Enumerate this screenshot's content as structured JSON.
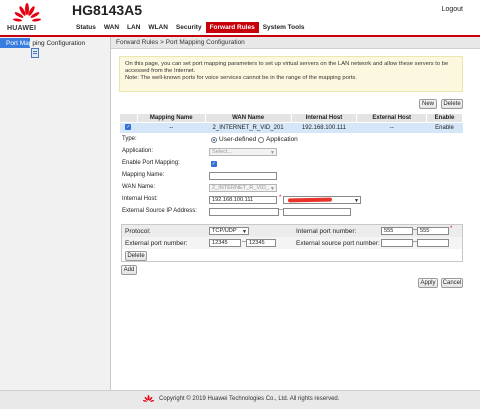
{
  "header": {
    "brand": "HUAWEI",
    "model": "HG8143A5",
    "logout": "Logout",
    "nav": [
      "Status",
      "WAN",
      "LAN",
      "WLAN",
      "Security",
      "Forward Rules",
      "System Tools"
    ],
    "active_nav": "Forward Rules"
  },
  "sidebar": {
    "item_highlight": "Port Map",
    "item_rest": "ping Configuration"
  },
  "breadcrumb": "Forward Rules > Port Mapping Configuration",
  "notice": {
    "line1": "On this page, you can set port mapping parameters to set up virtual servers on the LAN network and allow these servers to be",
    "line2": "accessed from the Internet.",
    "line3": "Note: The well-known ports for voice services cannot be in the range of the mapping ports."
  },
  "buttons": {
    "new": "New",
    "delete": "Delete",
    "delete_sub": "Delete",
    "add": "Add",
    "apply": "Apply",
    "cancel": "Cancel"
  },
  "table": {
    "headers": [
      "",
      "Mapping Name",
      "WAN Name",
      "Internal Host",
      "External Host",
      "Enable"
    ],
    "row": {
      "mapping_name": "--",
      "wan_name": "2_INTERNET_R_VID_201",
      "internal_host": "192.168.100.111",
      "external_host": "--",
      "enable": "Enable"
    }
  },
  "form": {
    "type_label": "Type:",
    "type_user": "User-defined",
    "type_app": "Application",
    "application_label": "Application:",
    "application_value": "Select...",
    "enable_label": "Enable Port Mapping:",
    "mapping_name_label": "Mapping Name:",
    "mapping_name_value": "",
    "wan_label": "WAN Name:",
    "wan_value": "2_INTERNET_R_VID_",
    "internal_host_label": "Internal Host:",
    "internal_host_value": "192.168.100.111",
    "ext_src_label": "External Source IP Address:",
    "required_mark": "*",
    "dash": "—"
  },
  "ports": {
    "protocol_label": "Protocol:",
    "protocol_value": "TCP/UDP",
    "internal_port_label": "Internal port number:",
    "internal_port_start": "555",
    "internal_port_end": "555",
    "external_port_label": "External port number:",
    "external_port_start": "12345",
    "external_port_end": "12345",
    "external_src_port_label": "External source port number:"
  },
  "footer": {
    "copyright": "Copyright © 2019 Huawei Technologies Co., Ltd. All rights reserved."
  },
  "colors": {
    "accent": "#c7000b",
    "selected_row": "#d4e6f7",
    "notice_bg": "#fbf8df",
    "sidebar_highlight": "#3a7de0"
  }
}
